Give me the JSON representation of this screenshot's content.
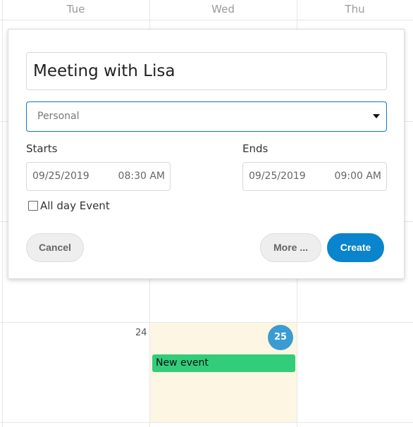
{
  "calendar": {
    "day_headers": [
      "Tue",
      "Wed",
      "Thu"
    ],
    "visible_day_numbers": {
      "tuesday": "24",
      "wednesday": "25"
    },
    "today_highlight_color": "#fdf6e3",
    "today_badge_color": "#3b9bd3",
    "events": [
      {
        "title": "New event",
        "day": "25",
        "color": "#32cd7a"
      }
    ]
  },
  "popup": {
    "title_value": "Meeting with Lisa",
    "category": {
      "selected": "Personal",
      "border_color": "#0b7cc4"
    },
    "starts": {
      "label": "Starts",
      "date": "09/25/2019",
      "time": "08:30 AM"
    },
    "ends": {
      "label": "Ends",
      "date": "09/25/2019",
      "time": "09:00 AM"
    },
    "all_day": {
      "label": "All day Event",
      "checked": false
    },
    "buttons": {
      "cancel": "Cancel",
      "more": "More ...",
      "create": "Create"
    },
    "primary_color": "#0a84cc"
  }
}
